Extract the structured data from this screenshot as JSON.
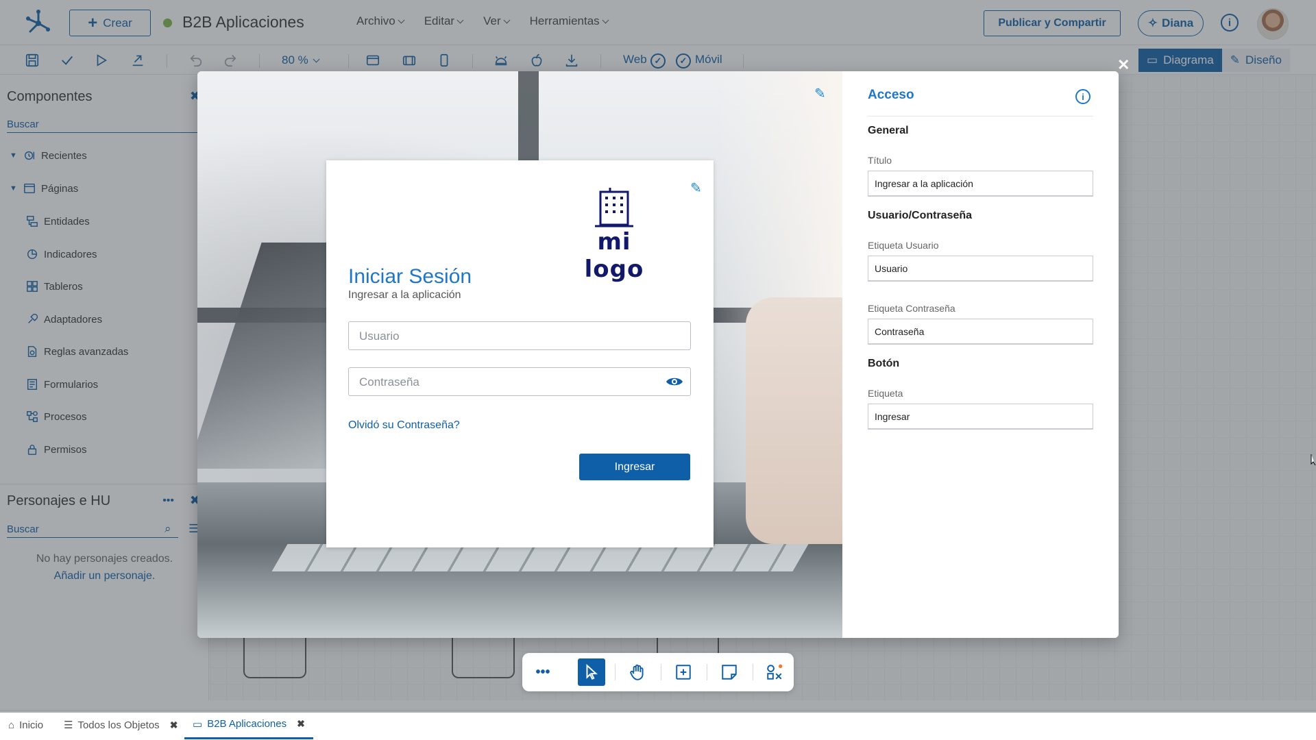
{
  "header": {
    "create_label": "Crear",
    "project_title": "B2B Aplicaciones",
    "menu": [
      "Archivo",
      "Editar",
      "Ver",
      "Herramientas"
    ],
    "publish_label": "Publicar y Compartir",
    "assistant_label": "Diana",
    "info_icon": "info-icon",
    "status_color": "#7ab648"
  },
  "toolbar": {
    "zoom": "80 %",
    "web_label": "Web",
    "mobile_label": "Móvil",
    "view_diagram": "Diagrama",
    "view_design": "Diseño"
  },
  "sidebar": {
    "components_title": "Componentes",
    "search_placeholder": "Buscar",
    "items": [
      {
        "label": "Recientes",
        "icon": "recent-icon",
        "expandable": true
      },
      {
        "label": "Páginas",
        "icon": "pages-icon",
        "expandable": true
      },
      {
        "label": "Entidades",
        "icon": "entities-icon"
      },
      {
        "label": "Indicadores",
        "icon": "indicators-icon"
      },
      {
        "label": "Tableros",
        "icon": "boards-icon"
      },
      {
        "label": "Adaptadores",
        "icon": "adapters-icon"
      },
      {
        "label": "Reglas avanzadas",
        "icon": "rules-icon"
      },
      {
        "label": "Formularios",
        "icon": "forms-icon"
      },
      {
        "label": "Procesos",
        "icon": "processes-icon"
      },
      {
        "label": "Permisos",
        "icon": "permissions-icon"
      }
    ],
    "personas_title": "Personajes e HU",
    "personas_search": "Buscar",
    "personas_empty": "No hay personajes creados.",
    "personas_add": "Añadir un personaje."
  },
  "tabs": [
    {
      "label": "Inicio",
      "icon": "home-icon",
      "closable": false
    },
    {
      "label": "Todos los Objetos",
      "icon": "list-icon",
      "closable": true
    },
    {
      "label": "B2B Aplicaciones",
      "icon": "folder-icon",
      "closable": true,
      "active": true
    }
  ],
  "login": {
    "logo_text": "mi logo",
    "title": "Iniciar Sesión",
    "subtitle": "Ingresar a la aplicación",
    "user_placeholder": "Usuario",
    "password_placeholder": "Contraseña",
    "forgot": "Olvidó su Contraseña?",
    "button": "Ingresar"
  },
  "properties": {
    "title": "Acceso",
    "general_section": "General",
    "title_label": "Título",
    "title_value": "Ingresar a la aplicación",
    "credentials_section": "Usuario/Contraseña",
    "user_label": "Etiqueta Usuario",
    "user_value": "Usuario",
    "password_label": "Etiqueta Contraseña",
    "password_value": "Contraseña",
    "button_section": "Botón",
    "button_label": "Etiqueta",
    "button_value": "Ingresar"
  },
  "colors": {
    "primary": "#0f5fa8",
    "accent": "#1f77c6",
    "logo": "#12196b"
  }
}
